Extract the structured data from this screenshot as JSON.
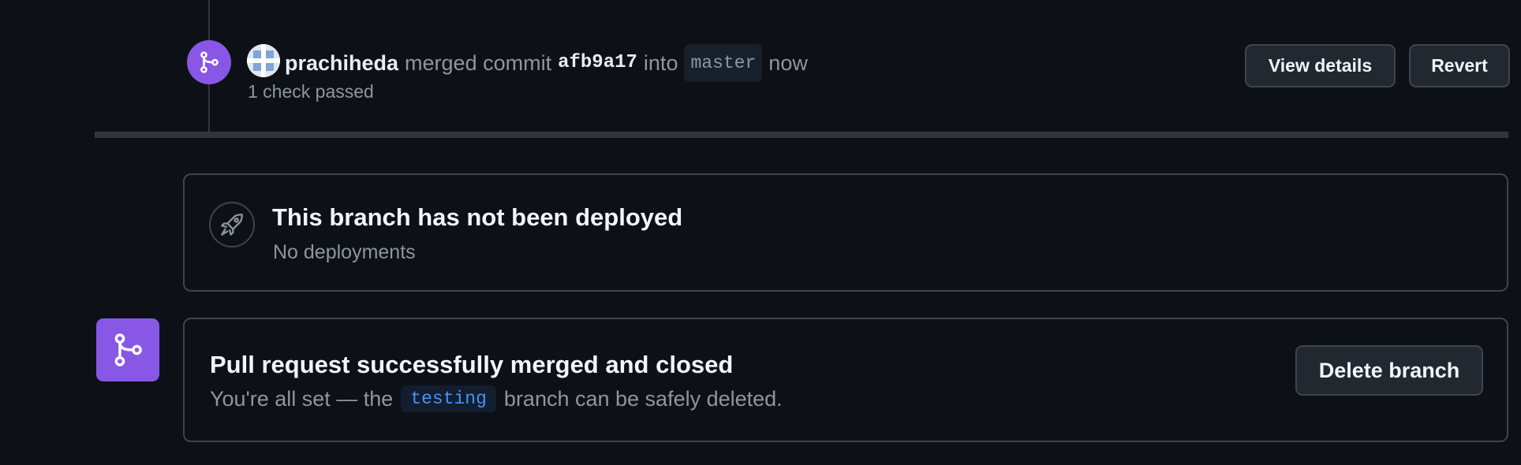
{
  "event": {
    "actor": "prachiheda",
    "action": "merged commit",
    "commit_sha": "afb9a17",
    "into": "into",
    "branch": "master",
    "time": "now",
    "checks": "1 check passed",
    "view_details_label": "View details",
    "revert_label": "Revert"
  },
  "deployment": {
    "title": "This branch has not been deployed",
    "subtitle": "No deployments"
  },
  "merge_status": {
    "title": "Pull request successfully merged and closed",
    "sub_prefix": "You're all set — the",
    "branch": "testing",
    "sub_suffix": "branch can be safely deleted.",
    "delete_branch_label": "Delete branch"
  },
  "colors": {
    "background": "#0d1117",
    "merged_purple": "#8957e5",
    "border": "#3d444d",
    "muted_text": "#8d96a0",
    "link_blue": "#4493f8"
  },
  "icons": {
    "merge_badge": "git-merge-icon",
    "rocket": "rocket-icon",
    "merged_status": "git-merge-icon"
  }
}
